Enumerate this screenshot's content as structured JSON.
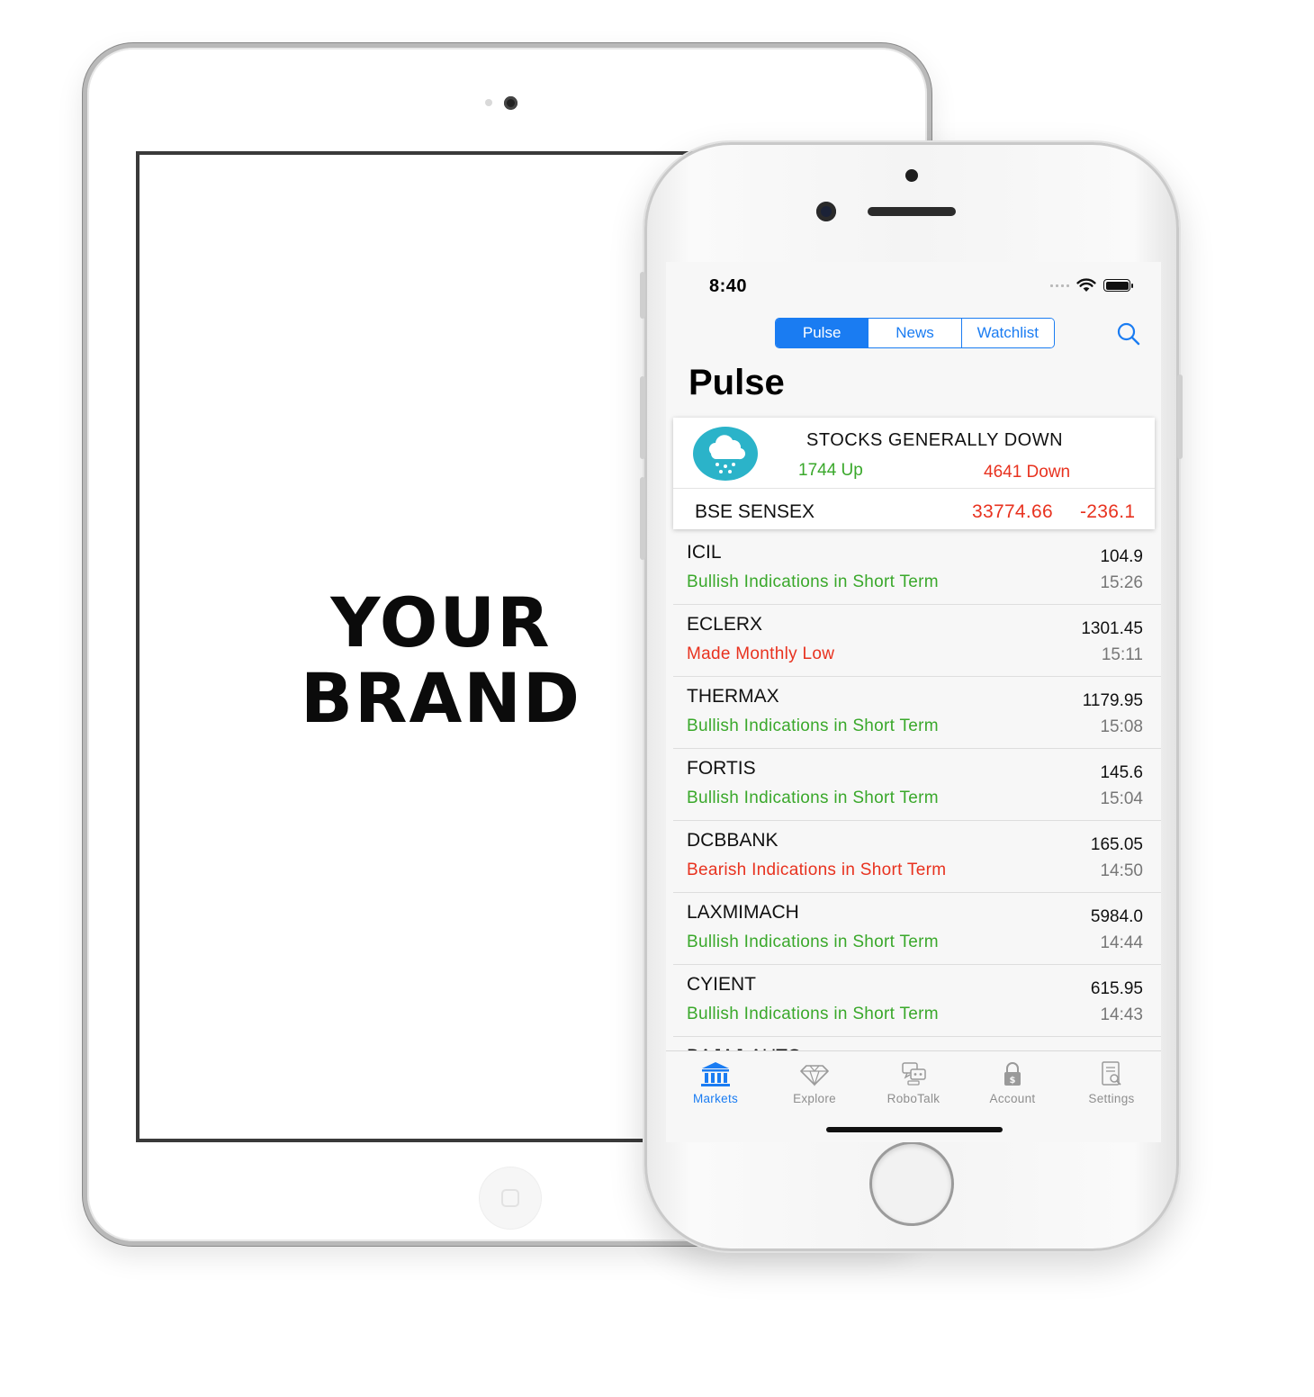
{
  "tablet": {
    "brand_line1": "YOUR",
    "brand_line2": "BRAND"
  },
  "status_bar": {
    "time": "8:40"
  },
  "segments": [
    {
      "label": "Pulse",
      "active": true
    },
    {
      "label": "News",
      "active": false
    },
    {
      "label": "Watchlist",
      "active": false
    }
  ],
  "page_title": "Pulse",
  "summary": {
    "headline": "STOCKS GENERALLY DOWN",
    "up": "1744 Up",
    "down": "4641 Down",
    "index_name": "BSE SENSEX",
    "index_value": "33774.66",
    "index_change": "-236.1"
  },
  "stocks": [
    {
      "symbol": "ICIL",
      "signal": "Bullish Indications in Short Term",
      "sentiment": "bull",
      "price": "104.9",
      "time": "15:26"
    },
    {
      "symbol": "ECLERX",
      "signal": "Made Monthly Low",
      "sentiment": "bear",
      "price": "1301.45",
      "time": "15:11"
    },
    {
      "symbol": "THERMAX",
      "signal": "Bullish Indications in Short Term",
      "sentiment": "bull",
      "price": "1179.95",
      "time": "15:08"
    },
    {
      "symbol": "FORTIS",
      "signal": "Bullish Indications in Short Term",
      "sentiment": "bull",
      "price": "145.6",
      "time": "15:04"
    },
    {
      "symbol": "DCBBANK",
      "signal": "Bearish Indications in Short Term",
      "sentiment": "bear",
      "price": "165.05",
      "time": "14:50"
    },
    {
      "symbol": "LAXMIMACH",
      "signal": "Bullish Indications in Short Term",
      "sentiment": "bull",
      "price": "5984.0",
      "time": "14:44"
    },
    {
      "symbol": "CYIENT",
      "signal": "Bullish Indications in Short Term",
      "sentiment": "bull",
      "price": "615.95",
      "time": "14:43"
    }
  ],
  "partial_row": {
    "symbol": "BAJAJ-AUTO"
  },
  "tabs": [
    {
      "label": "Markets",
      "icon": "bank-icon",
      "active": true
    },
    {
      "label": "Explore",
      "icon": "diamond-icon",
      "active": false
    },
    {
      "label": "RoboTalk",
      "icon": "robot-chat-icon",
      "active": false
    },
    {
      "label": "Account",
      "icon": "lock-icon",
      "active": false
    },
    {
      "label": "Settings",
      "icon": "document-search-icon",
      "active": false
    }
  ],
  "colors": {
    "accent": "#1a7cf2",
    "bull": "#3aa82b",
    "bear": "#e8321f",
    "weather_icon": "#2bb3c9"
  }
}
